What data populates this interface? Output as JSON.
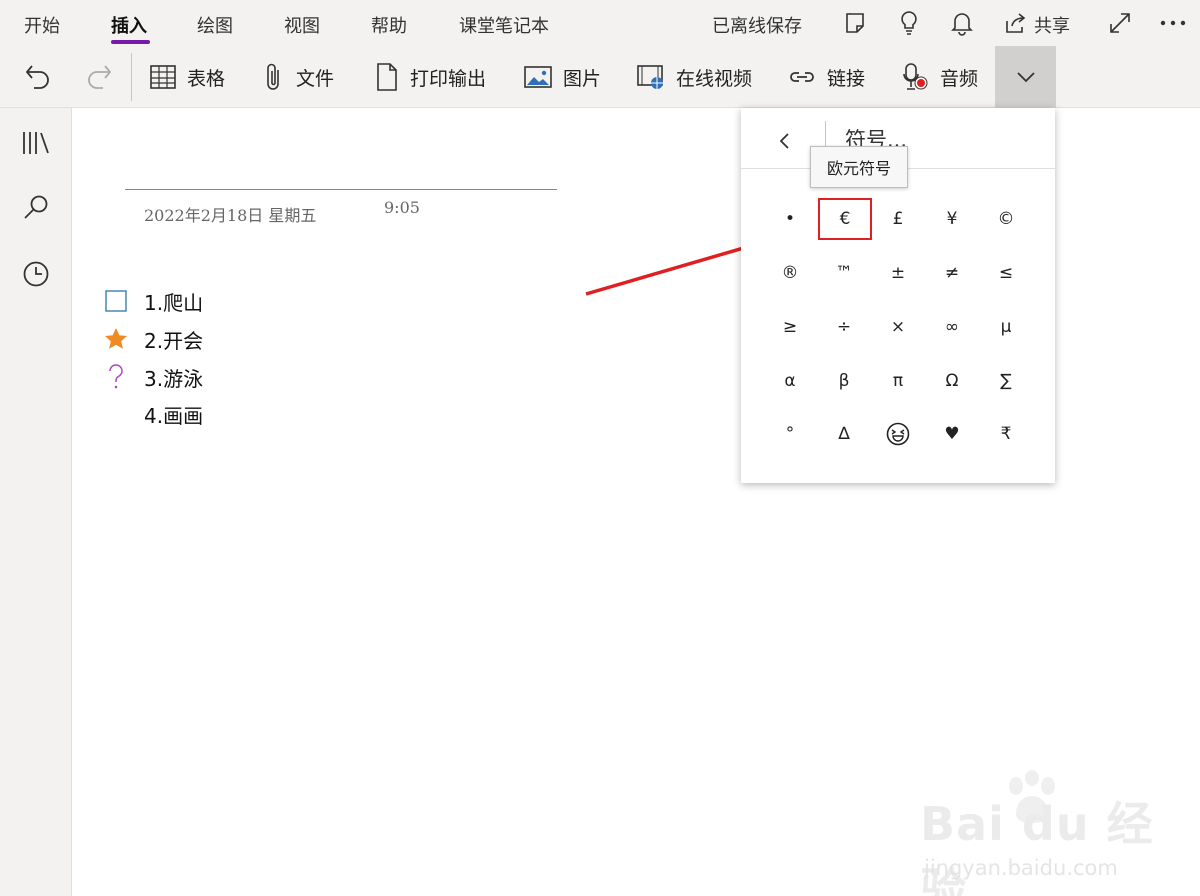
{
  "menu": {
    "tabs": [
      "开始",
      "插入",
      "绘图",
      "视图",
      "帮助",
      "课堂笔记本"
    ],
    "active_tab": "插入",
    "status": "已离线保存",
    "share_label": "共享"
  },
  "ribbon": {
    "table_label": "表格",
    "file_label": "文件",
    "printout_label": "打印输出",
    "picture_label": "图片",
    "online_video_label": "在线视频",
    "link_label": "链接",
    "audio_label": "音频"
  },
  "page": {
    "date": "2022年2月18日 星期五",
    "time": "9:05",
    "items": [
      {
        "text": "1.爬山",
        "tag": "checkbox"
      },
      {
        "text": "2.开会",
        "tag": "star"
      },
      {
        "text": "3.游泳",
        "tag": "question"
      },
      {
        "text": "4.画画",
        "tag": "none"
      }
    ]
  },
  "symbol_panel": {
    "title": "符号...",
    "tooltip": "欧元符号",
    "selected": "€",
    "rows": [
      [
        "•",
        "€",
        "£",
        "¥",
        "©"
      ],
      [
        "®",
        "™",
        "±",
        "≠",
        "≤"
      ],
      [
        "≥",
        "÷",
        "×",
        "∞",
        "µ"
      ],
      [
        "α",
        "β",
        "π",
        "Ω",
        "∑"
      ],
      [
        "°",
        "∆",
        "😆",
        "♥",
        "₹"
      ]
    ]
  },
  "watermark": {
    "brand": "Bai du 经验",
    "url": "jingyan.baidu.com"
  },
  "colors": {
    "accent": "#7719aa",
    "highlight": "#e02020",
    "star": "#f08a24",
    "question": "#b146c2"
  }
}
